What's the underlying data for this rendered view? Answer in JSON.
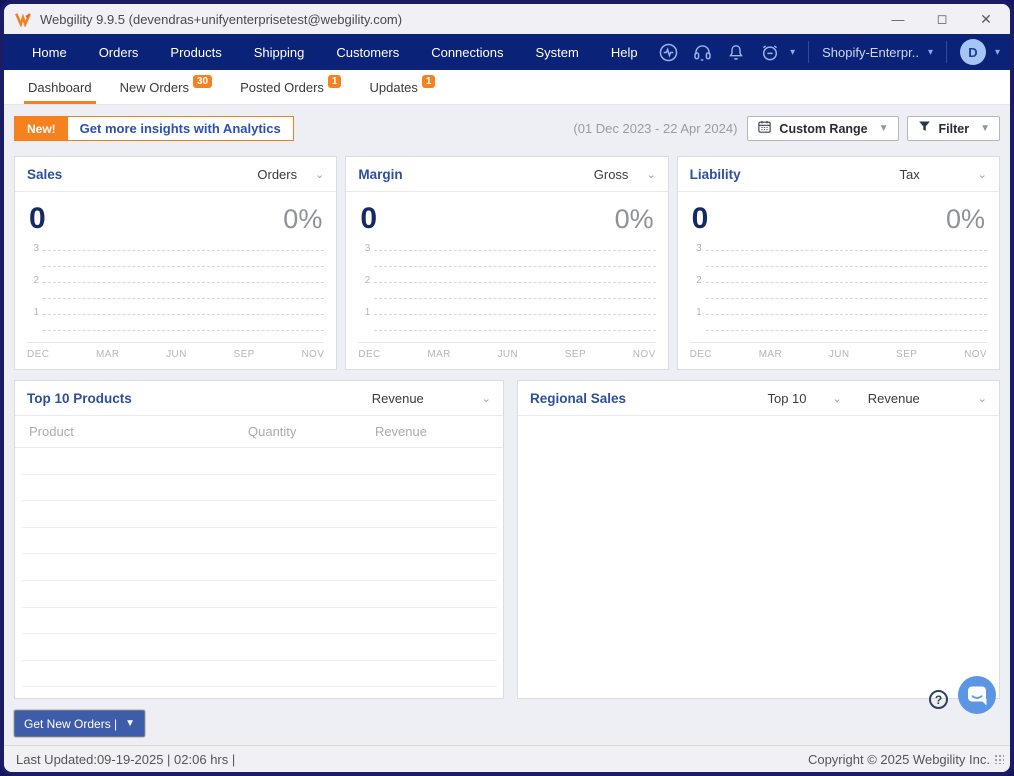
{
  "window": {
    "title": "Webgility 9.9.5 (devendras+unifyenterprisetest@webgility.com)",
    "controls": {
      "minimize": "—",
      "maximize": "◻",
      "close": "✕"
    }
  },
  "menubar": {
    "items": [
      "Home",
      "Orders",
      "Products",
      "Shipping",
      "Customers",
      "Connections",
      "System",
      "Help"
    ],
    "store_selector": "Shopify-Enterpr..",
    "avatar_letter": "D"
  },
  "tabs": [
    {
      "label": "Dashboard",
      "active": true
    },
    {
      "label": "New Orders",
      "badge": "30"
    },
    {
      "label": "Posted Orders",
      "badge": "1"
    },
    {
      "label": "Updates",
      "badge": "1"
    }
  ],
  "toolbar": {
    "new_flag": "New!",
    "analytics_label": "Get more insights with Analytics",
    "date_range": "(01 Dec 2023 - 22 Apr 2024)",
    "custom_range_label": "Custom Range",
    "filter_label": "Filter"
  },
  "kpis": [
    {
      "title": "Sales",
      "metric": "Orders",
      "value": "0",
      "percent": "0%"
    },
    {
      "title": "Margin",
      "metric": "Gross",
      "value": "0",
      "percent": "0%"
    },
    {
      "title": "Liability",
      "metric": "Tax",
      "value": "0",
      "percent": "0%"
    }
  ],
  "chart_axes": {
    "y_ticks": [
      "3",
      "2",
      "1"
    ],
    "x_ticks": [
      "DEC",
      "MAR",
      "JUN",
      "SEP",
      "NOV"
    ]
  },
  "chart_data": [
    {
      "type": "line",
      "title": "Sales (Orders)",
      "x": [
        "DEC",
        "MAR",
        "JUN",
        "SEP",
        "NOV"
      ],
      "series": [],
      "ylim": [
        0,
        3.5
      ],
      "y_ticks": [
        3,
        2,
        1
      ],
      "grid": "dashed-horizontal"
    },
    {
      "type": "line",
      "title": "Margin (Gross)",
      "x": [
        "DEC",
        "MAR",
        "JUN",
        "SEP",
        "NOV"
      ],
      "series": [],
      "ylim": [
        0,
        3.5
      ],
      "y_ticks": [
        3,
        2,
        1
      ],
      "grid": "dashed-horizontal"
    },
    {
      "type": "line",
      "title": "Liability (Tax)",
      "x": [
        "DEC",
        "MAR",
        "JUN",
        "SEP",
        "NOV"
      ],
      "series": [],
      "ylim": [
        0,
        3.5
      ],
      "y_ticks": [
        3,
        2,
        1
      ],
      "grid": "dashed-horizontal"
    }
  ],
  "products": {
    "title": "Top 10 Products",
    "metric": "Revenue",
    "columns": [
      "Product",
      "Quantity",
      "Revenue"
    ],
    "row_count": 10,
    "rows": []
  },
  "regional": {
    "title": "Regional Sales",
    "range_selector": "Top 10",
    "metric": "Revenue"
  },
  "actions": {
    "get_new_orders": "Get New Orders |",
    "help": "?"
  },
  "statusbar": {
    "left": "Last Updated:09-19-2025 | 02:06 hrs |",
    "right": "Copyright © 2025 Webgility Inc."
  },
  "colors": {
    "menubar_navy": "#0a2277",
    "accent_orange": "#f5821f",
    "heading_blue": "#2e4f9e",
    "value_navy": "#152a63",
    "button_blue": "#3d5ca9",
    "chat_blue": "#5a96e3"
  }
}
